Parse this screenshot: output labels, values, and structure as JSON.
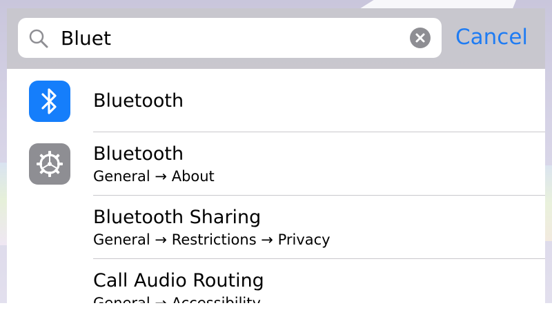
{
  "search": {
    "value": "Bluet",
    "cancel_label": "Cancel"
  },
  "icons": {
    "search": "search-icon",
    "clear": "clear-icon",
    "bluetooth": "bluetooth-icon",
    "settings": "gear-icon"
  },
  "colors": {
    "accent": "#1f7cf3",
    "bluetooth_tile": "#157efb",
    "settings_tile": "#8e8e93",
    "search_bar_bg": "#c8c7cc"
  },
  "results": [
    {
      "title": "Bluetooth",
      "subtitle": ""
    },
    {
      "title": "Bluetooth",
      "subtitle": "General → About"
    },
    {
      "title": "Bluetooth Sharing",
      "subtitle": "General → Restrictions → Privacy"
    },
    {
      "title": "Call Audio Routing",
      "subtitle": "General → Accessibility"
    }
  ]
}
